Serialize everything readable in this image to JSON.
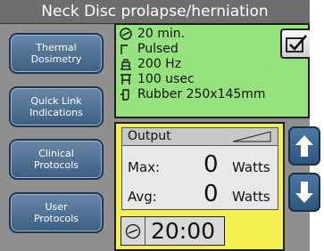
{
  "header": {
    "title": "Neck Disc prolapse/herniation"
  },
  "sidebar": {
    "items": [
      {
        "label": "Thermal\nDosimetry"
      },
      {
        "label": "Quick Link\nIndications"
      },
      {
        "label": "Clinical\nProtocols"
      },
      {
        "label": "User\nProtocols"
      }
    ]
  },
  "settings": {
    "duration": "20 min.",
    "mode": "Pulsed",
    "frequency": "200 Hz",
    "pulse_width": "100 usec",
    "applicator": "Rubber 250x145mm",
    "confirm_icon": "checkbox-check-icon"
  },
  "output": {
    "header_label": "Output",
    "max_label": "Max:",
    "max_value": "0",
    "max_unit": "Watts",
    "avg_label": "Avg:",
    "avg_value": "0",
    "avg_unit": "Watts"
  },
  "timer": {
    "value": "20:00"
  },
  "colors": {
    "settings_bg": "#96e27e",
    "output_bg": "#f4ef53",
    "button_blue": "#3d5f84",
    "title_bg": "#6e6e6e"
  }
}
